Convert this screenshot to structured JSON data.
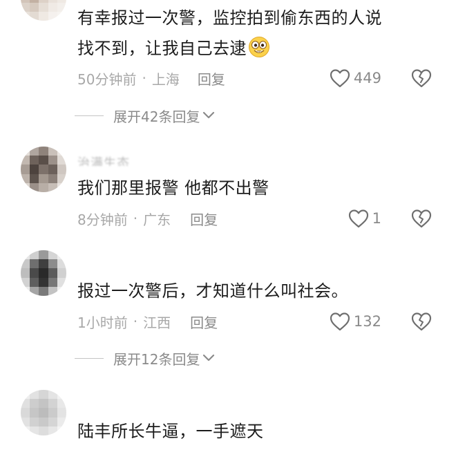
{
  "comments": [
    {
      "username": "",
      "text_lines": [
        "有幸报过一次警，监控拍到偷东西的人说",
        "找不到，让我自己去逮"
      ],
      "emoji": "grinning-face-emoji",
      "time": "50分钟前",
      "location": "上海",
      "reply_label": "回复",
      "likes": "449",
      "expand_label": "展开42条回复"
    },
    {
      "username": "治满生态",
      "text_lines": [
        "我们那里报警 他都不出警"
      ],
      "time": "8分钟前",
      "location": "广东",
      "reply_label": "回复",
      "likes": "1"
    },
    {
      "username": "",
      "text_lines": [
        "报过一次警后，才知道什么叫社会。"
      ],
      "time": "1小时前",
      "location": "江西",
      "reply_label": "回复",
      "likes": "132",
      "expand_label": "展开12条回复"
    },
    {
      "username": "",
      "text_lines": [
        "陆丰所长牛逼，一手遮天"
      ]
    }
  ],
  "separator": "·",
  "icons": {
    "like": "heart-outline-icon",
    "dislike": "broken-heart-icon",
    "expand": "chevron-down-icon"
  }
}
